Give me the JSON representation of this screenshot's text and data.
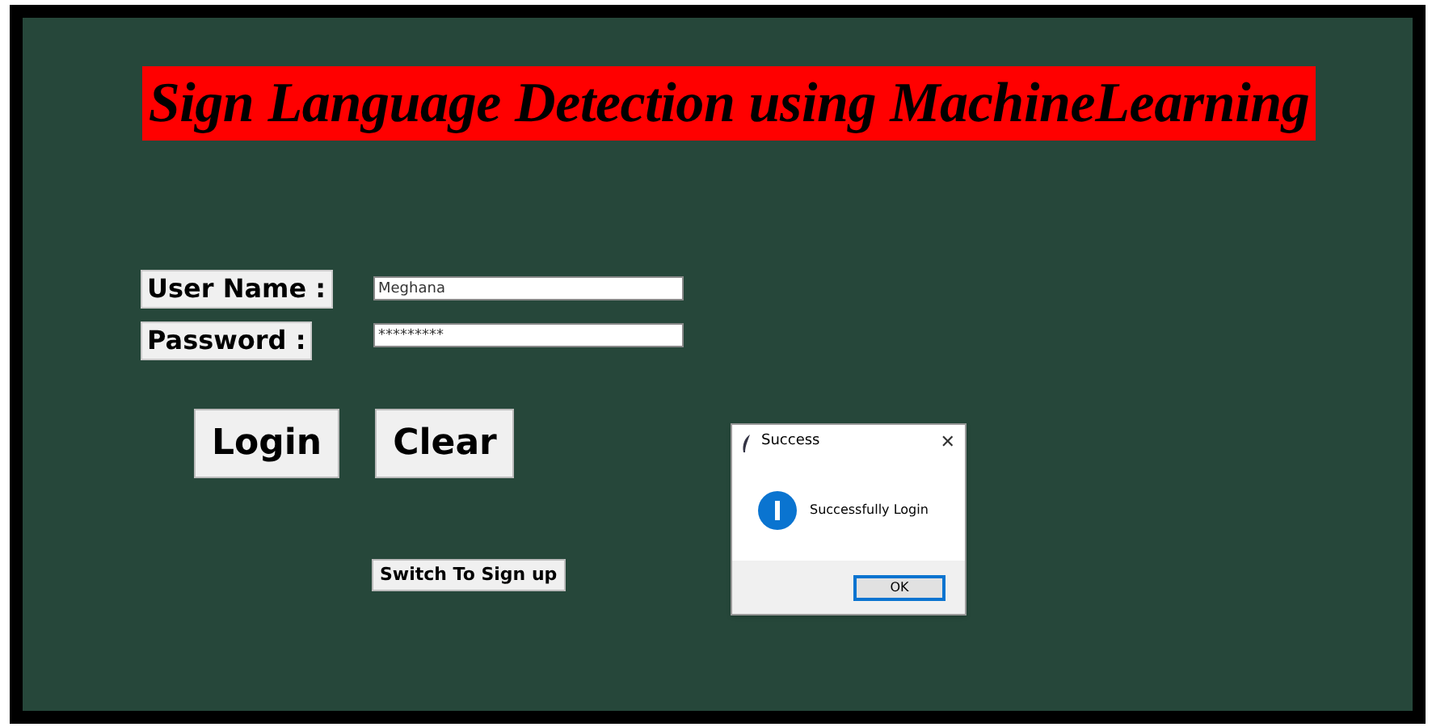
{
  "title": "Sign Language Detection using MachineLearning",
  "fields": [
    {
      "label": "User Name :",
      "value": "Meghana"
    },
    {
      "label": "Password :",
      "value": "*********"
    }
  ],
  "buttons": [
    "Login",
    "Clear"
  ],
  "switch_button": "Switch To Sign up",
  "dialog": {
    "title": "Success",
    "close": "✕",
    "message": "Successfully Login",
    "button": "OK"
  }
}
